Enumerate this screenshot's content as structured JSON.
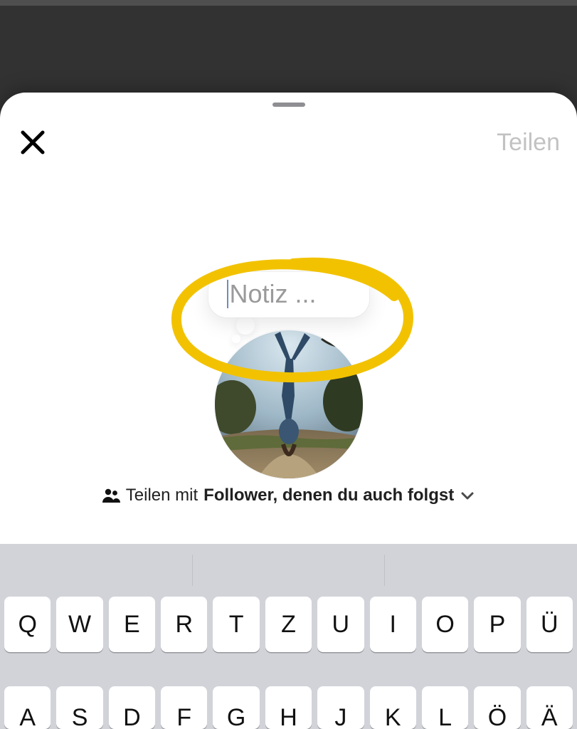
{
  "header": {
    "share_label": "Teilen"
  },
  "note": {
    "placeholder": "Notiz ...",
    "value": ""
  },
  "share_with": {
    "prefix": "Teilen mit",
    "audience": "Follower, denen du auch folgst"
  },
  "keyboard": {
    "row1": [
      "Q",
      "W",
      "E",
      "R",
      "T",
      "Z",
      "U",
      "I",
      "O",
      "P",
      "Ü"
    ],
    "row2": [
      "A",
      "S",
      "D",
      "F",
      "G",
      "H",
      "J",
      "K",
      "L",
      "Ö",
      "Ä"
    ]
  },
  "icons": {
    "close": "close-icon",
    "people": "people-icon",
    "chevron_down": "chevron-down-icon"
  },
  "annotation": {
    "color": "#f2c200"
  }
}
